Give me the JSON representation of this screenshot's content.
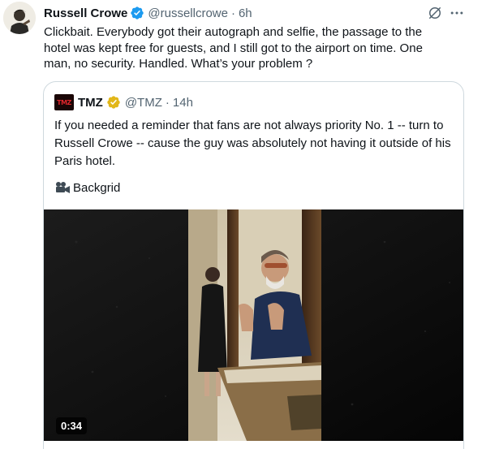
{
  "tweet": {
    "author_name": "Russell Crowe",
    "author_handle": "@russellcrowe",
    "separator": "·",
    "time": "6h",
    "text": "Clickbait. Everybody got their autograph and selfie, the passage to the hotel was kept free for guests, and I still got to the airport on time. One man, no security. Handled. What’s your problem ?",
    "icons": {
      "verified": "verified-badge-icon",
      "grok": "grok-icon",
      "more": "more-options-icon",
      "avatar": "profile-avatar"
    }
  },
  "quote": {
    "logo_text": "TMZ",
    "author_name": "TMZ",
    "author_handle": "@TMZ",
    "separator": "·",
    "time": "14h",
    "text": "If you needed a reminder that fans are not always priority No. 1 -- turn to Russell Crowe -- cause the guy was absolutely not having it outside of his Paris hotel.",
    "credit": "Backgrid",
    "video_duration": "0:34",
    "icons": {
      "verified": "gold-verified-badge-icon",
      "camera": "movie-camera-icon"
    }
  },
  "colors": {
    "text": "#0f1419",
    "secondary": "#536471",
    "verified_blue": "#1d9bf0",
    "verified_gold": "#e2b719",
    "border": "#cfd9de"
  }
}
